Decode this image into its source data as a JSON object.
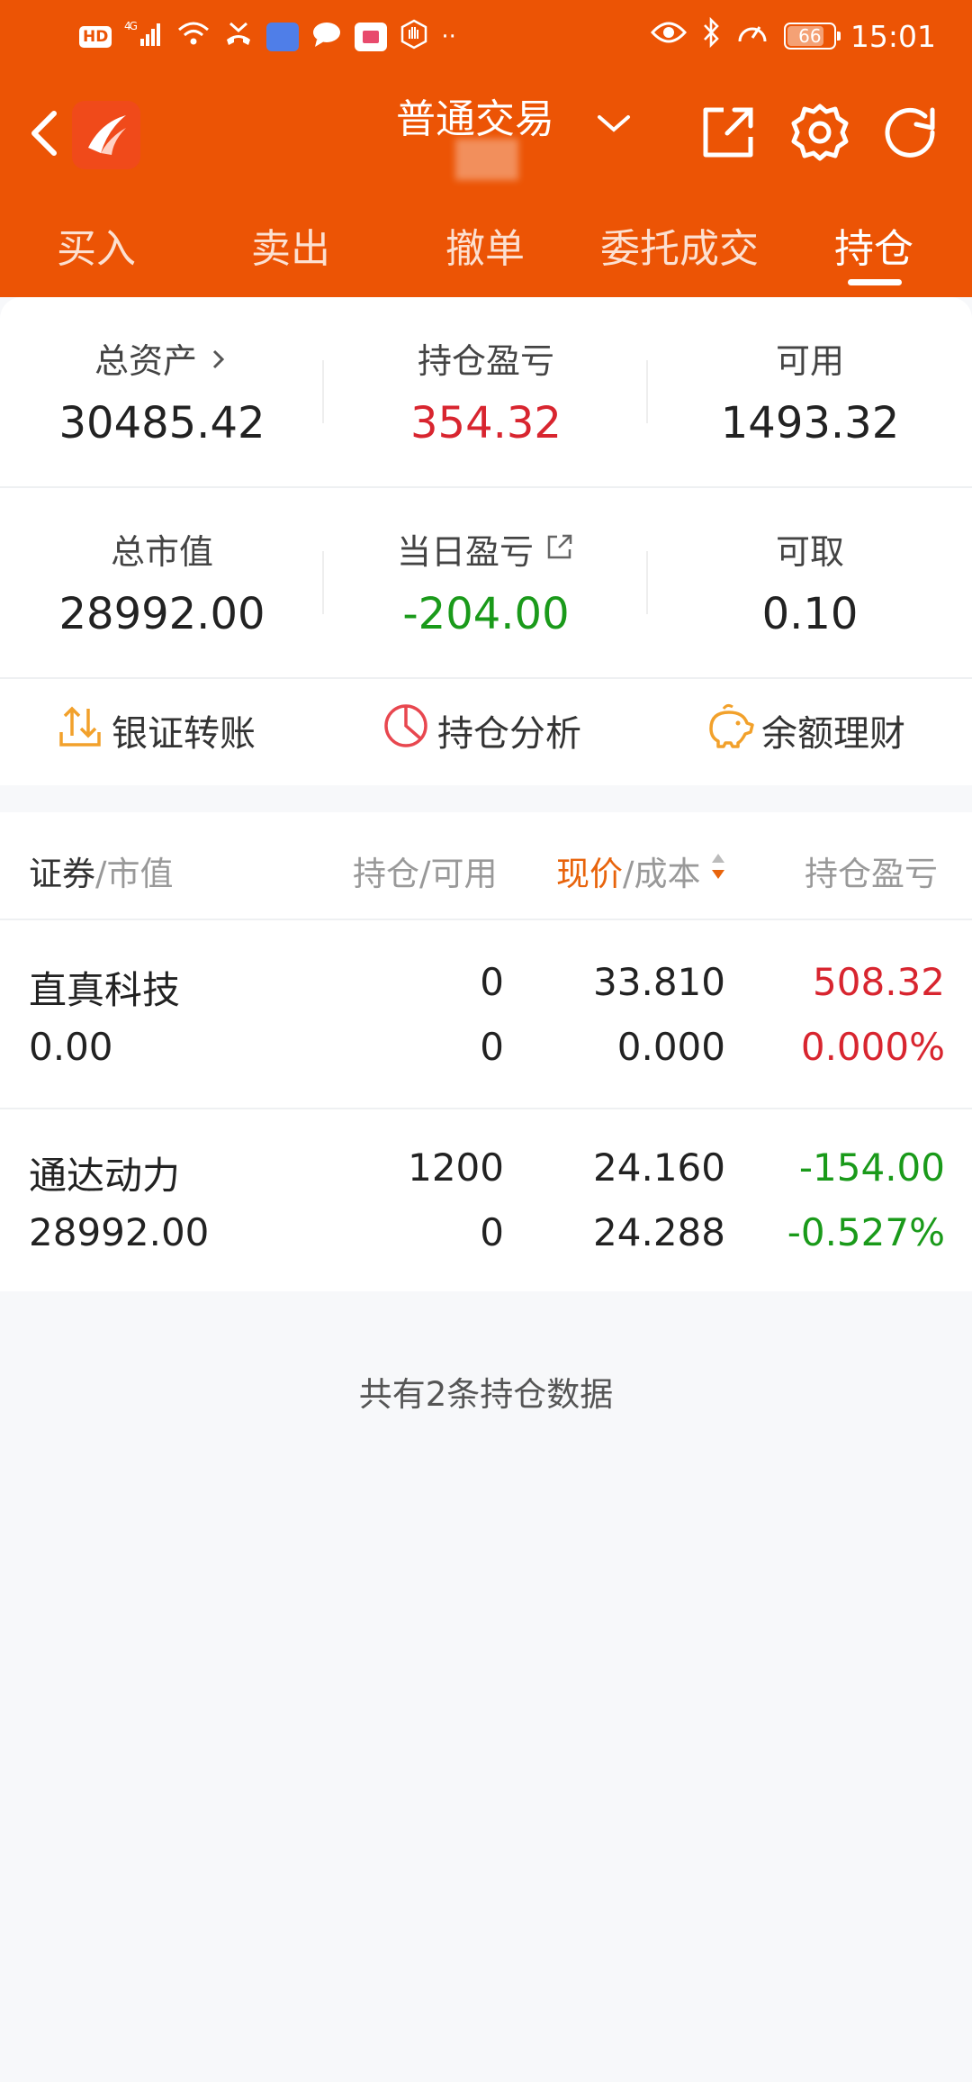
{
  "status_bar": {
    "hd": "HD",
    "network": "4G",
    "battery": "66",
    "time": "15:01"
  },
  "header": {
    "title": "普通交易"
  },
  "tabs": [
    {
      "label": "买入"
    },
    {
      "label": "卖出"
    },
    {
      "label": "撤单"
    },
    {
      "label": "委托成交"
    },
    {
      "label": "持仓"
    }
  ],
  "summary": {
    "total_assets_label": "总资产",
    "total_assets": "30485.42",
    "position_pnl_label": "持仓盈亏",
    "position_pnl": "354.32",
    "available_label": "可用",
    "available": "1493.32",
    "market_value_label": "总市值",
    "market_value": "28992.00",
    "daily_pnl_label": "当日盈亏",
    "daily_pnl": "-204.00",
    "withdrawable_label": "可取",
    "withdrawable": "0.10"
  },
  "actions": [
    {
      "label": "银证转账"
    },
    {
      "label": "持仓分析"
    },
    {
      "label": "余额理财"
    }
  ],
  "table": {
    "headers": {
      "security": "证券",
      "market_value": "/市值",
      "holding_available": "持仓/可用",
      "price": "现价",
      "cost": "/成本",
      "pnl": "持仓盈亏"
    },
    "rows": [
      {
        "name": "直真科技",
        "market_value": "0.00",
        "holding": "0",
        "available": "0",
        "price": "33.810",
        "cost": "0.000",
        "pnl": "508.32",
        "pnl_pct": "0.000%"
      },
      {
        "name": "通达动力",
        "market_value": "28992.00",
        "holding": "1200",
        "available": "0",
        "price": "24.160",
        "cost": "24.288",
        "pnl": "-154.00",
        "pnl_pct": "-0.527%"
      }
    ]
  },
  "footer": {
    "summary": "共有2条持仓数据"
  },
  "colors": {
    "brand": "#ec5405",
    "up": "#d8252f",
    "down": "#1a9a1a"
  }
}
